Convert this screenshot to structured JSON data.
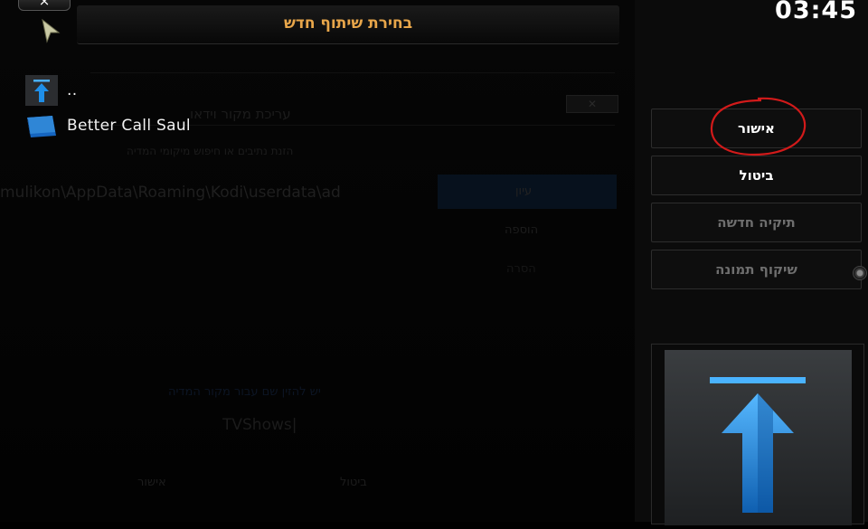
{
  "dialog": {
    "title": "בחירת שיתוף חדש",
    "close_label": "×",
    "files": [
      {
        "label": "..",
        "icon": "parent-folder-arrow-icon"
      },
      {
        "label": "Better Call Saul",
        "icon": "blue-folder-icon"
      }
    ]
  },
  "background_dialog": {
    "title": "עריכת מקור וידאו",
    "subtitle": "הזנת נתיבים או חיפוש מיקומי המדיה",
    "path": "mulikon\\AppData\\Roaming\\Kodi\\userdata\\ad",
    "side_items": [
      "עיון",
      "הוספה",
      "הסרה"
    ],
    "name_prompt": "יש להזין שם עבור מקור המדיה",
    "name_value": "TVShows|",
    "cancel": "ביטול",
    "ok": "אישור"
  },
  "sidebar": {
    "clock": "03:45",
    "buttons": [
      {
        "label": "אישור",
        "enabled": true
      },
      {
        "label": "ביטול",
        "enabled": true
      },
      {
        "label": "תיקיה חדשה",
        "enabled": false
      },
      {
        "label": "שיקוף תמונה",
        "enabled": false
      }
    ]
  },
  "colors": {
    "title": "#e8a64a",
    "accent_blue": "#1e8ce0",
    "annotation_red": "#d21a1a"
  }
}
